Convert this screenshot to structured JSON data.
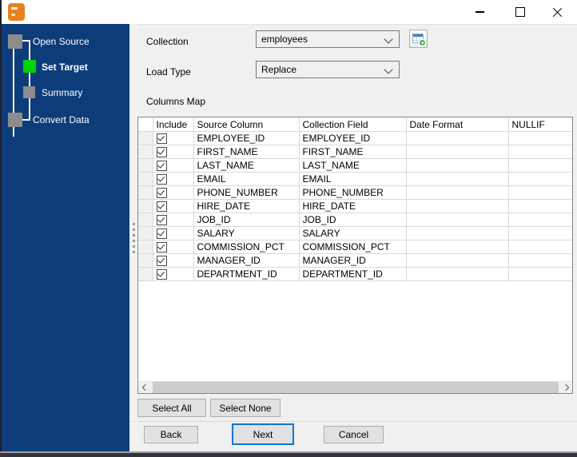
{
  "window": {
    "icons": {
      "app_icon": "orange-database-grid",
      "minimize_icon": "–",
      "maximize_icon": "▢",
      "close_icon": "✕",
      "dropdown_chevron_icon": "⌄",
      "add_collection_icon": "table-with-green-plus",
      "scroll_left_icon": "‹",
      "scroll_right_icon": "›"
    }
  },
  "sidebar": {
    "steps": [
      {
        "label": "Open Source",
        "state": "done"
      },
      {
        "label": "Set Target",
        "state": "active"
      },
      {
        "label": "Summary",
        "state": "pending"
      },
      {
        "label": "Convert Data",
        "state": "pending"
      }
    ]
  },
  "form": {
    "collection_label": "Collection",
    "collection_value": "employees",
    "load_type_label": "Load Type",
    "load_type_value": "Replace",
    "columns_map_label": "Columns Map"
  },
  "table": {
    "headers": [
      "",
      "Include",
      "Source Column",
      "Collection Field",
      "Date Format",
      "NULLIF"
    ],
    "rows": [
      {
        "include": true,
        "source": "EMPLOYEE_ID",
        "field": "EMPLOYEE_ID",
        "date_format": "",
        "nullif": ""
      },
      {
        "include": true,
        "source": "FIRST_NAME",
        "field": "FIRST_NAME",
        "date_format": "",
        "nullif": ""
      },
      {
        "include": true,
        "source": "LAST_NAME",
        "field": "LAST_NAME",
        "date_format": "",
        "nullif": ""
      },
      {
        "include": true,
        "source": "EMAIL",
        "field": "EMAIL",
        "date_format": "",
        "nullif": ""
      },
      {
        "include": true,
        "source": "PHONE_NUMBER",
        "field": "PHONE_NUMBER",
        "date_format": "",
        "nullif": ""
      },
      {
        "include": true,
        "source": "HIRE_DATE",
        "field": "HIRE_DATE",
        "date_format": "",
        "nullif": ""
      },
      {
        "include": true,
        "source": "JOB_ID",
        "field": "JOB_ID",
        "date_format": "",
        "nullif": ""
      },
      {
        "include": true,
        "source": "SALARY",
        "field": "SALARY",
        "date_format": "",
        "nullif": ""
      },
      {
        "include": true,
        "source": "COMMISSION_PCT",
        "field": "COMMISSION_PCT",
        "date_format": "",
        "nullif": ""
      },
      {
        "include": true,
        "source": "MANAGER_ID",
        "field": "MANAGER_ID",
        "date_format": "",
        "nullif": ""
      },
      {
        "include": true,
        "source": "DEPARTMENT_ID",
        "field": "DEPARTMENT_ID",
        "date_format": "",
        "nullif": ""
      }
    ]
  },
  "footer": {
    "select_all": "Select All",
    "select_none": "Select None",
    "back": "Back",
    "next": "Next",
    "cancel": "Cancel"
  },
  "colors": {
    "sidebar_bg": "#0D3C7A",
    "active_step_green": "#00D400",
    "step_gray": "#8C8C8C",
    "focus_blue": "#0078D7",
    "app_icon_orange": "#E8821E",
    "content_bg": "#F0F0F0"
  }
}
